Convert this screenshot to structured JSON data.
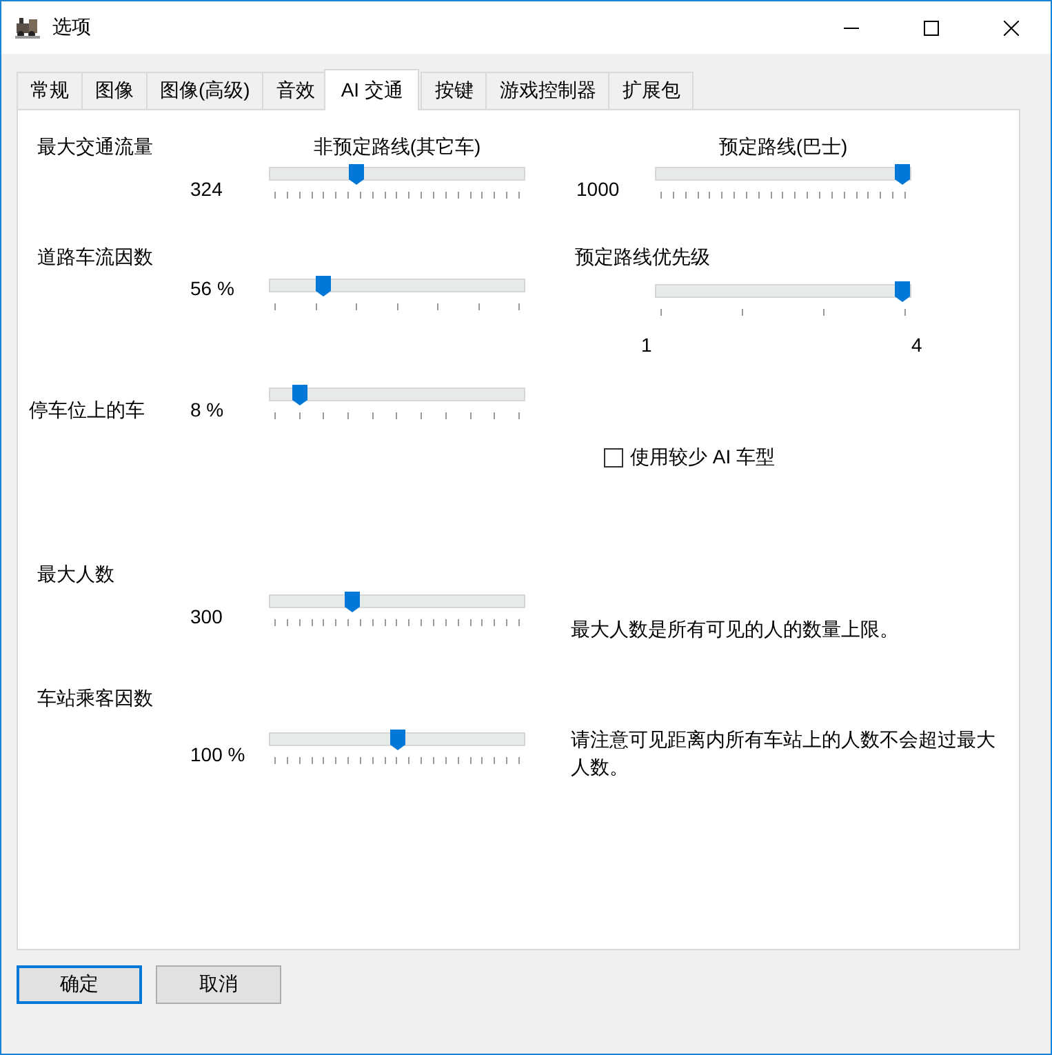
{
  "window": {
    "title": "选项"
  },
  "tabs": [
    {
      "label": "常规",
      "selected": false
    },
    {
      "label": "图像",
      "selected": false
    },
    {
      "label": "图像(高级)",
      "selected": false
    },
    {
      "label": "音效",
      "selected": false
    },
    {
      "label": "AI 交通",
      "selected": true
    },
    {
      "label": "按键",
      "selected": false
    },
    {
      "label": "游戏控制器",
      "selected": false
    },
    {
      "label": "扩展包",
      "selected": false
    }
  ],
  "sliders": [
    {
      "heading": "最大交通流量",
      "caption": "非预定路线(其它车)",
      "reading": "324",
      "level": 0.33
    },
    {
      "caption": "预定路线(巴士)",
      "reading": "1000",
      "level": 1.0
    },
    {
      "heading": "道路车流因数",
      "reading": "56 %",
      "level": 0.19
    },
    {
      "heading": "预定路线优先级",
      "level": 1.0,
      "min_label": "1",
      "max_label": "4"
    },
    {
      "heading": "停车位上的车",
      "reading": "8 %",
      "level": 0.09
    },
    {
      "heading": "最大人数",
      "reading": "300",
      "level": 0.31,
      "note": "最大人数是所有可见的人的数量上限。"
    },
    {
      "heading": "车站乘客因数",
      "reading": "100 %",
      "level": 0.5,
      "note": "请注意可见距离内所有车站上的人数不会超过最大人数。"
    }
  ],
  "checkbox": {
    "label": "使用较少 AI 车型",
    "checked": false
  },
  "buttons": [
    {
      "label": "确定",
      "default": true
    },
    {
      "label": "取消",
      "default": false
    }
  ]
}
